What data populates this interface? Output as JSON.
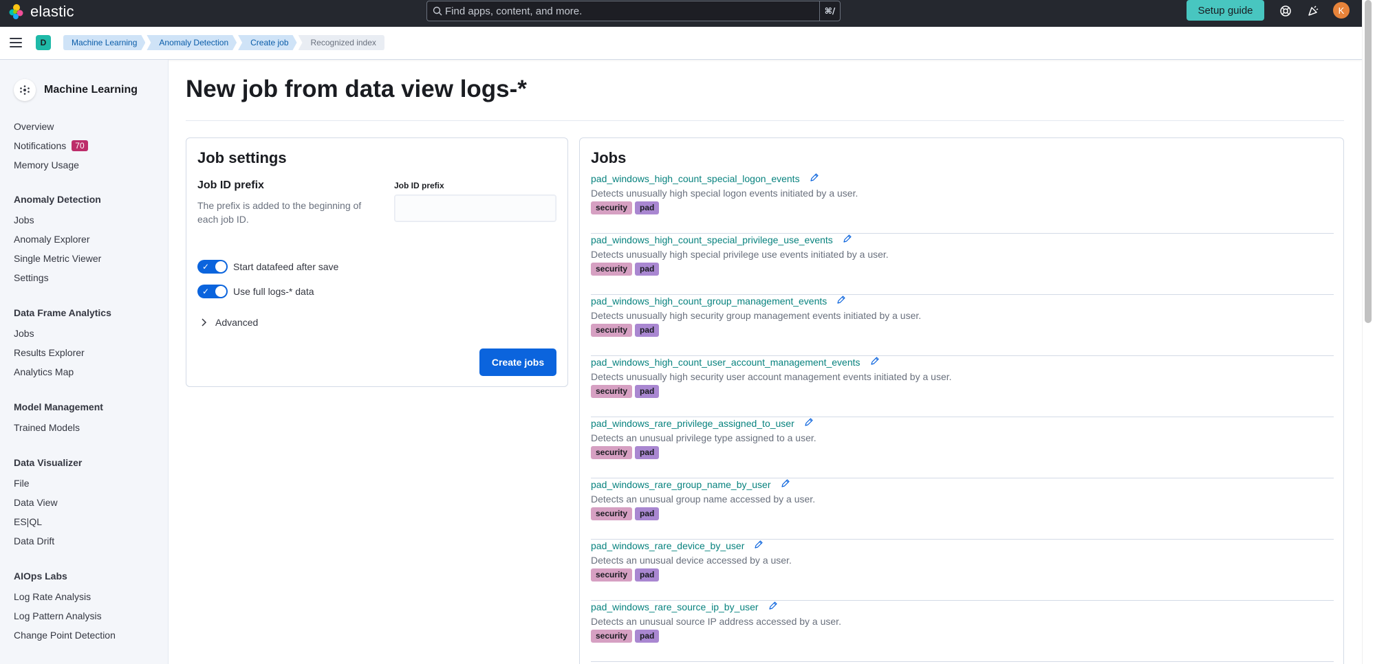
{
  "header": {
    "logo_text": "elastic",
    "search_placeholder": "Find apps, content, and more.",
    "search_shortcut": "⌘/",
    "setup_guide": "Setup guide",
    "avatar_initial": "K"
  },
  "breadcrumb": {
    "space_initial": "D",
    "items": [
      "Machine Learning",
      "Anomaly Detection",
      "Create job",
      "Recognized index"
    ]
  },
  "sidebar": {
    "title": "Machine Learning",
    "overview": "Overview",
    "notifications": "Notifications",
    "notifications_count": "70",
    "memory_usage": "Memory Usage",
    "anomaly_heading": "Anomaly Detection",
    "anomaly_jobs": "Jobs",
    "anomaly_explorer": "Anomaly Explorer",
    "single_metric": "Single Metric Viewer",
    "settings": "Settings",
    "dfa_heading": "Data Frame Analytics",
    "dfa_jobs": "Jobs",
    "results_explorer": "Results Explorer",
    "analytics_map": "Analytics Map",
    "model_heading": "Model Management",
    "trained_models": "Trained Models",
    "dv_heading": "Data Visualizer",
    "file": "File",
    "data_view": "Data View",
    "esql": "ES|QL",
    "data_drift": "Data Drift",
    "aiops_heading": "AIOps Labs",
    "log_rate": "Log Rate Analysis",
    "log_pattern": "Log Pattern Analysis",
    "change_point": "Change Point Detection"
  },
  "page": {
    "title": "New job from data view logs-*"
  },
  "job_settings": {
    "title": "Job settings",
    "prefix_heading": "Job ID prefix",
    "prefix_desc": "The prefix is added to the beginning of each job ID.",
    "prefix_label": "Job ID prefix",
    "prefix_value": "",
    "start_datafeed": "Start datafeed after save",
    "use_full_data": "Use full logs-* data",
    "advanced": "Advanced",
    "create_jobs": "Create jobs"
  },
  "jobs": {
    "title": "Jobs",
    "items": [
      {
        "name": "pad_windows_high_count_special_logon_events",
        "desc": "Detects unusually high special logon events initiated by a user.",
        "tags": [
          "security",
          "pad"
        ]
      },
      {
        "name": "pad_windows_high_count_special_privilege_use_events",
        "desc": "Detects unusually high special privilege use events initiated by a user.",
        "tags": [
          "security",
          "pad"
        ]
      },
      {
        "name": "pad_windows_high_count_group_management_events",
        "desc": "Detects unusually high security group management events initiated by a user.",
        "tags": [
          "security",
          "pad"
        ]
      },
      {
        "name": "pad_windows_high_count_user_account_management_events",
        "desc": "Detects unusually high security user account management events initiated by a user.",
        "tags": [
          "security",
          "pad"
        ]
      },
      {
        "name": "pad_windows_rare_privilege_assigned_to_user",
        "desc": "Detects an unusual privilege type assigned to a user.",
        "tags": [
          "security",
          "pad"
        ]
      },
      {
        "name": "pad_windows_rare_group_name_by_user",
        "desc": "Detects an unusual group name accessed by a user.",
        "tags": [
          "security",
          "pad"
        ]
      },
      {
        "name": "pad_windows_rare_device_by_user",
        "desc": "Detects an unusual device accessed by a user.",
        "tags": [
          "security",
          "pad"
        ]
      },
      {
        "name": "pad_windows_rare_source_ip_by_user",
        "desc": "Detects an unusual source IP address accessed by a user.",
        "tags": [
          "security",
          "pad"
        ]
      }
    ]
  },
  "colors": {
    "link": "#07827e",
    "primary": "#0b64dd",
    "accent": "#48c6c0",
    "tag_security": "#d6a0c2",
    "tag_pad": "#a987d1"
  }
}
